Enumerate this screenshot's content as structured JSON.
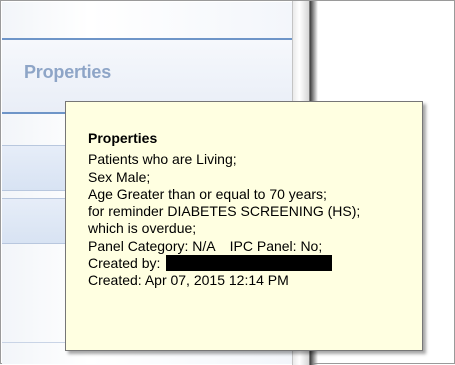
{
  "panel": {
    "header_label": "Properties"
  },
  "tooltip": {
    "title": "Properties",
    "lines": [
      "Patients who are Living;",
      "Sex Male;",
      "Age Greater than or equal to 70 years;",
      "for reminder DIABETES SCREENING (HS);",
      "which is overdue;"
    ],
    "panel_category": "Panel Category: N/A",
    "ipc_panel": "IPC Panel: No;",
    "created_by_label": "Created by:",
    "created_date": "Created: Apr 07, 2015 12:14 PM"
  }
}
